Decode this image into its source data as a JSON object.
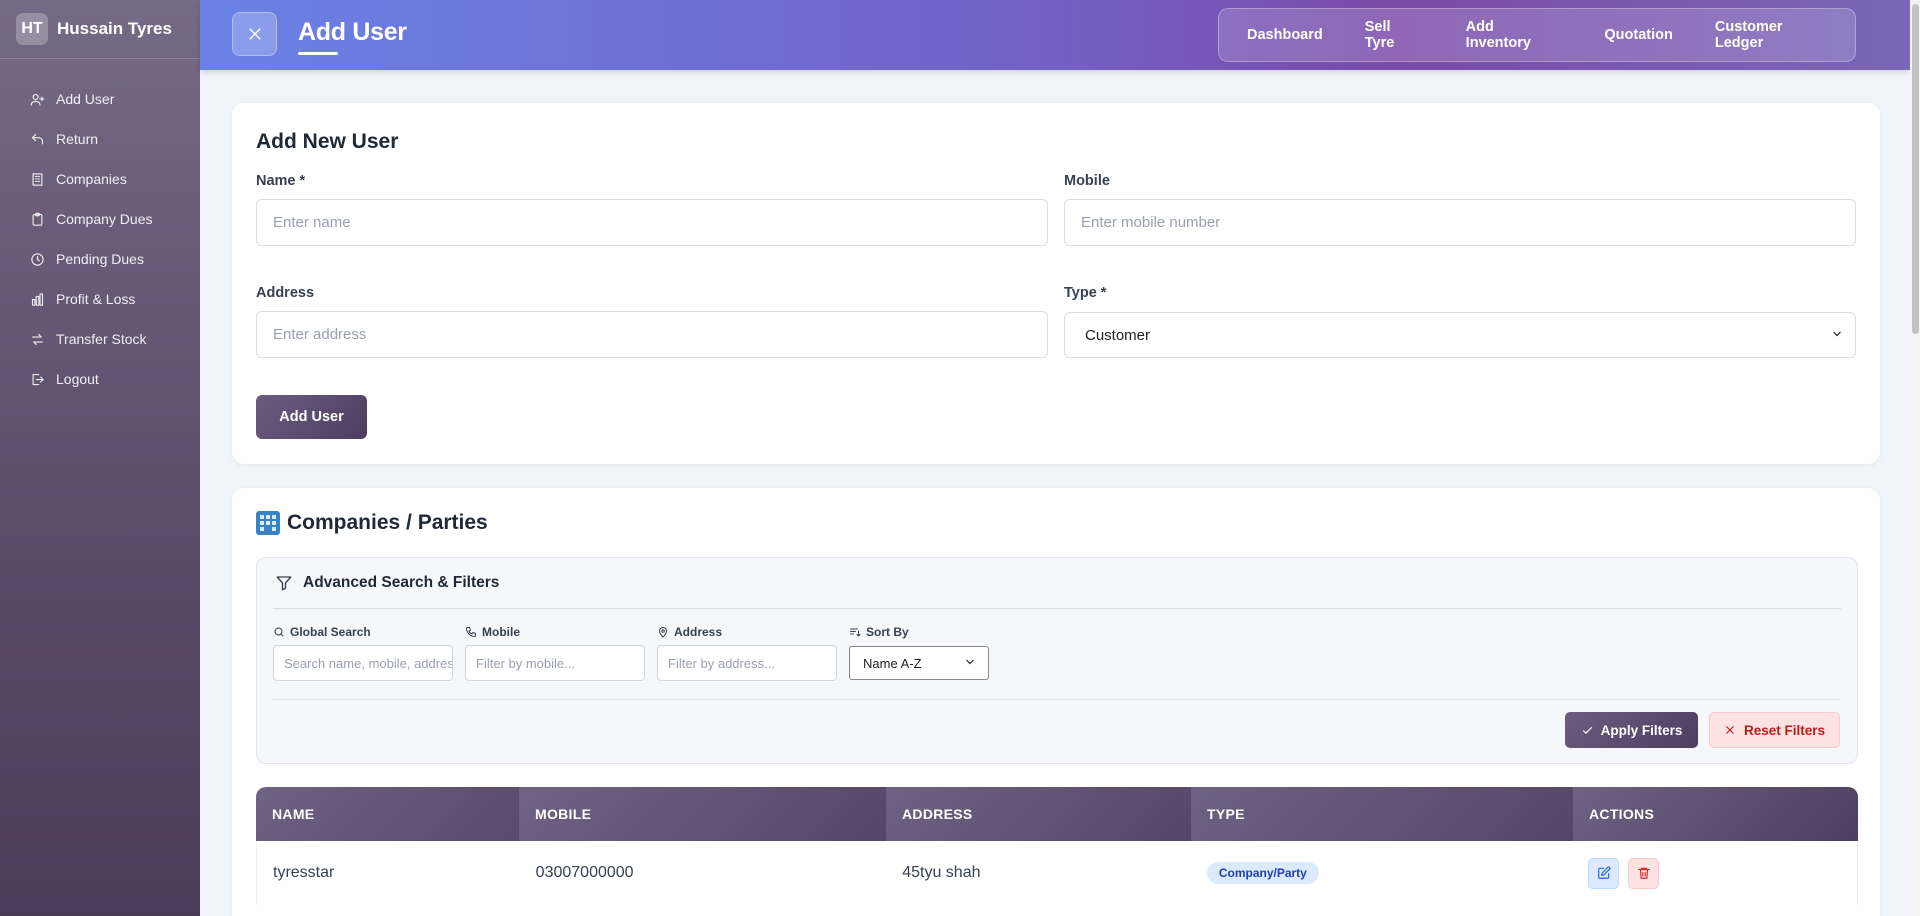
{
  "sidebar": {
    "logo_text": "HT",
    "brand_name": "Hussain Tyres",
    "items": [
      {
        "label": "Add User",
        "icon": "user-plus-icon"
      },
      {
        "label": "Return",
        "icon": "undo-icon"
      },
      {
        "label": "Companies",
        "icon": "building-icon"
      },
      {
        "label": "Company Dues",
        "icon": "clipboard-icon"
      },
      {
        "label": "Pending Dues",
        "icon": "clock-icon"
      },
      {
        "label": "Profit & Loss",
        "icon": "bar-chart-icon"
      },
      {
        "label": "Transfer Stock",
        "icon": "transfer-icon"
      },
      {
        "label": "Logout",
        "icon": "logout-icon"
      }
    ]
  },
  "header": {
    "title": "Add User",
    "nav": [
      "Dashboard",
      "Sell Tyre",
      "Add Inventory",
      "Quotation",
      "Customer Ledger"
    ]
  },
  "add_form": {
    "title": "Add New User",
    "name_label": "Name *",
    "name_placeholder": "Enter name",
    "mobile_label": "Mobile",
    "mobile_placeholder": "Enter mobile number",
    "address_label": "Address",
    "address_placeholder": "Enter address",
    "type_label": "Type *",
    "type_value": "Customer",
    "submit_label": "Add User"
  },
  "list": {
    "title": "Companies / Parties",
    "filters": {
      "title": "Advanced Search & Filters",
      "global_label": "Global Search",
      "global_placeholder": "Search name, mobile, address...",
      "mobile_label": "Mobile",
      "mobile_placeholder": "Filter by mobile...",
      "address_label": "Address",
      "address_placeholder": "Filter by address...",
      "sort_label": "Sort By",
      "sort_value": "Name A-Z",
      "apply_label": "Apply Filters",
      "reset_label": "Reset Filters"
    },
    "columns": [
      "NAME",
      "MOBILE",
      "ADDRESS",
      "TYPE",
      "ACTIONS"
    ],
    "rows": [
      {
        "name": "tyresstar",
        "mobile": "03007000000",
        "address": "45tyu shah",
        "type": "Company/Party"
      }
    ]
  },
  "colors": {
    "sidebar": "#5e4f6d",
    "header_start": "#6a82e6",
    "header_end": "#7a4aa8",
    "primary": "#5d4d70",
    "badge_bg": "#dbeafe",
    "reset_bg": "#fde2e2"
  }
}
